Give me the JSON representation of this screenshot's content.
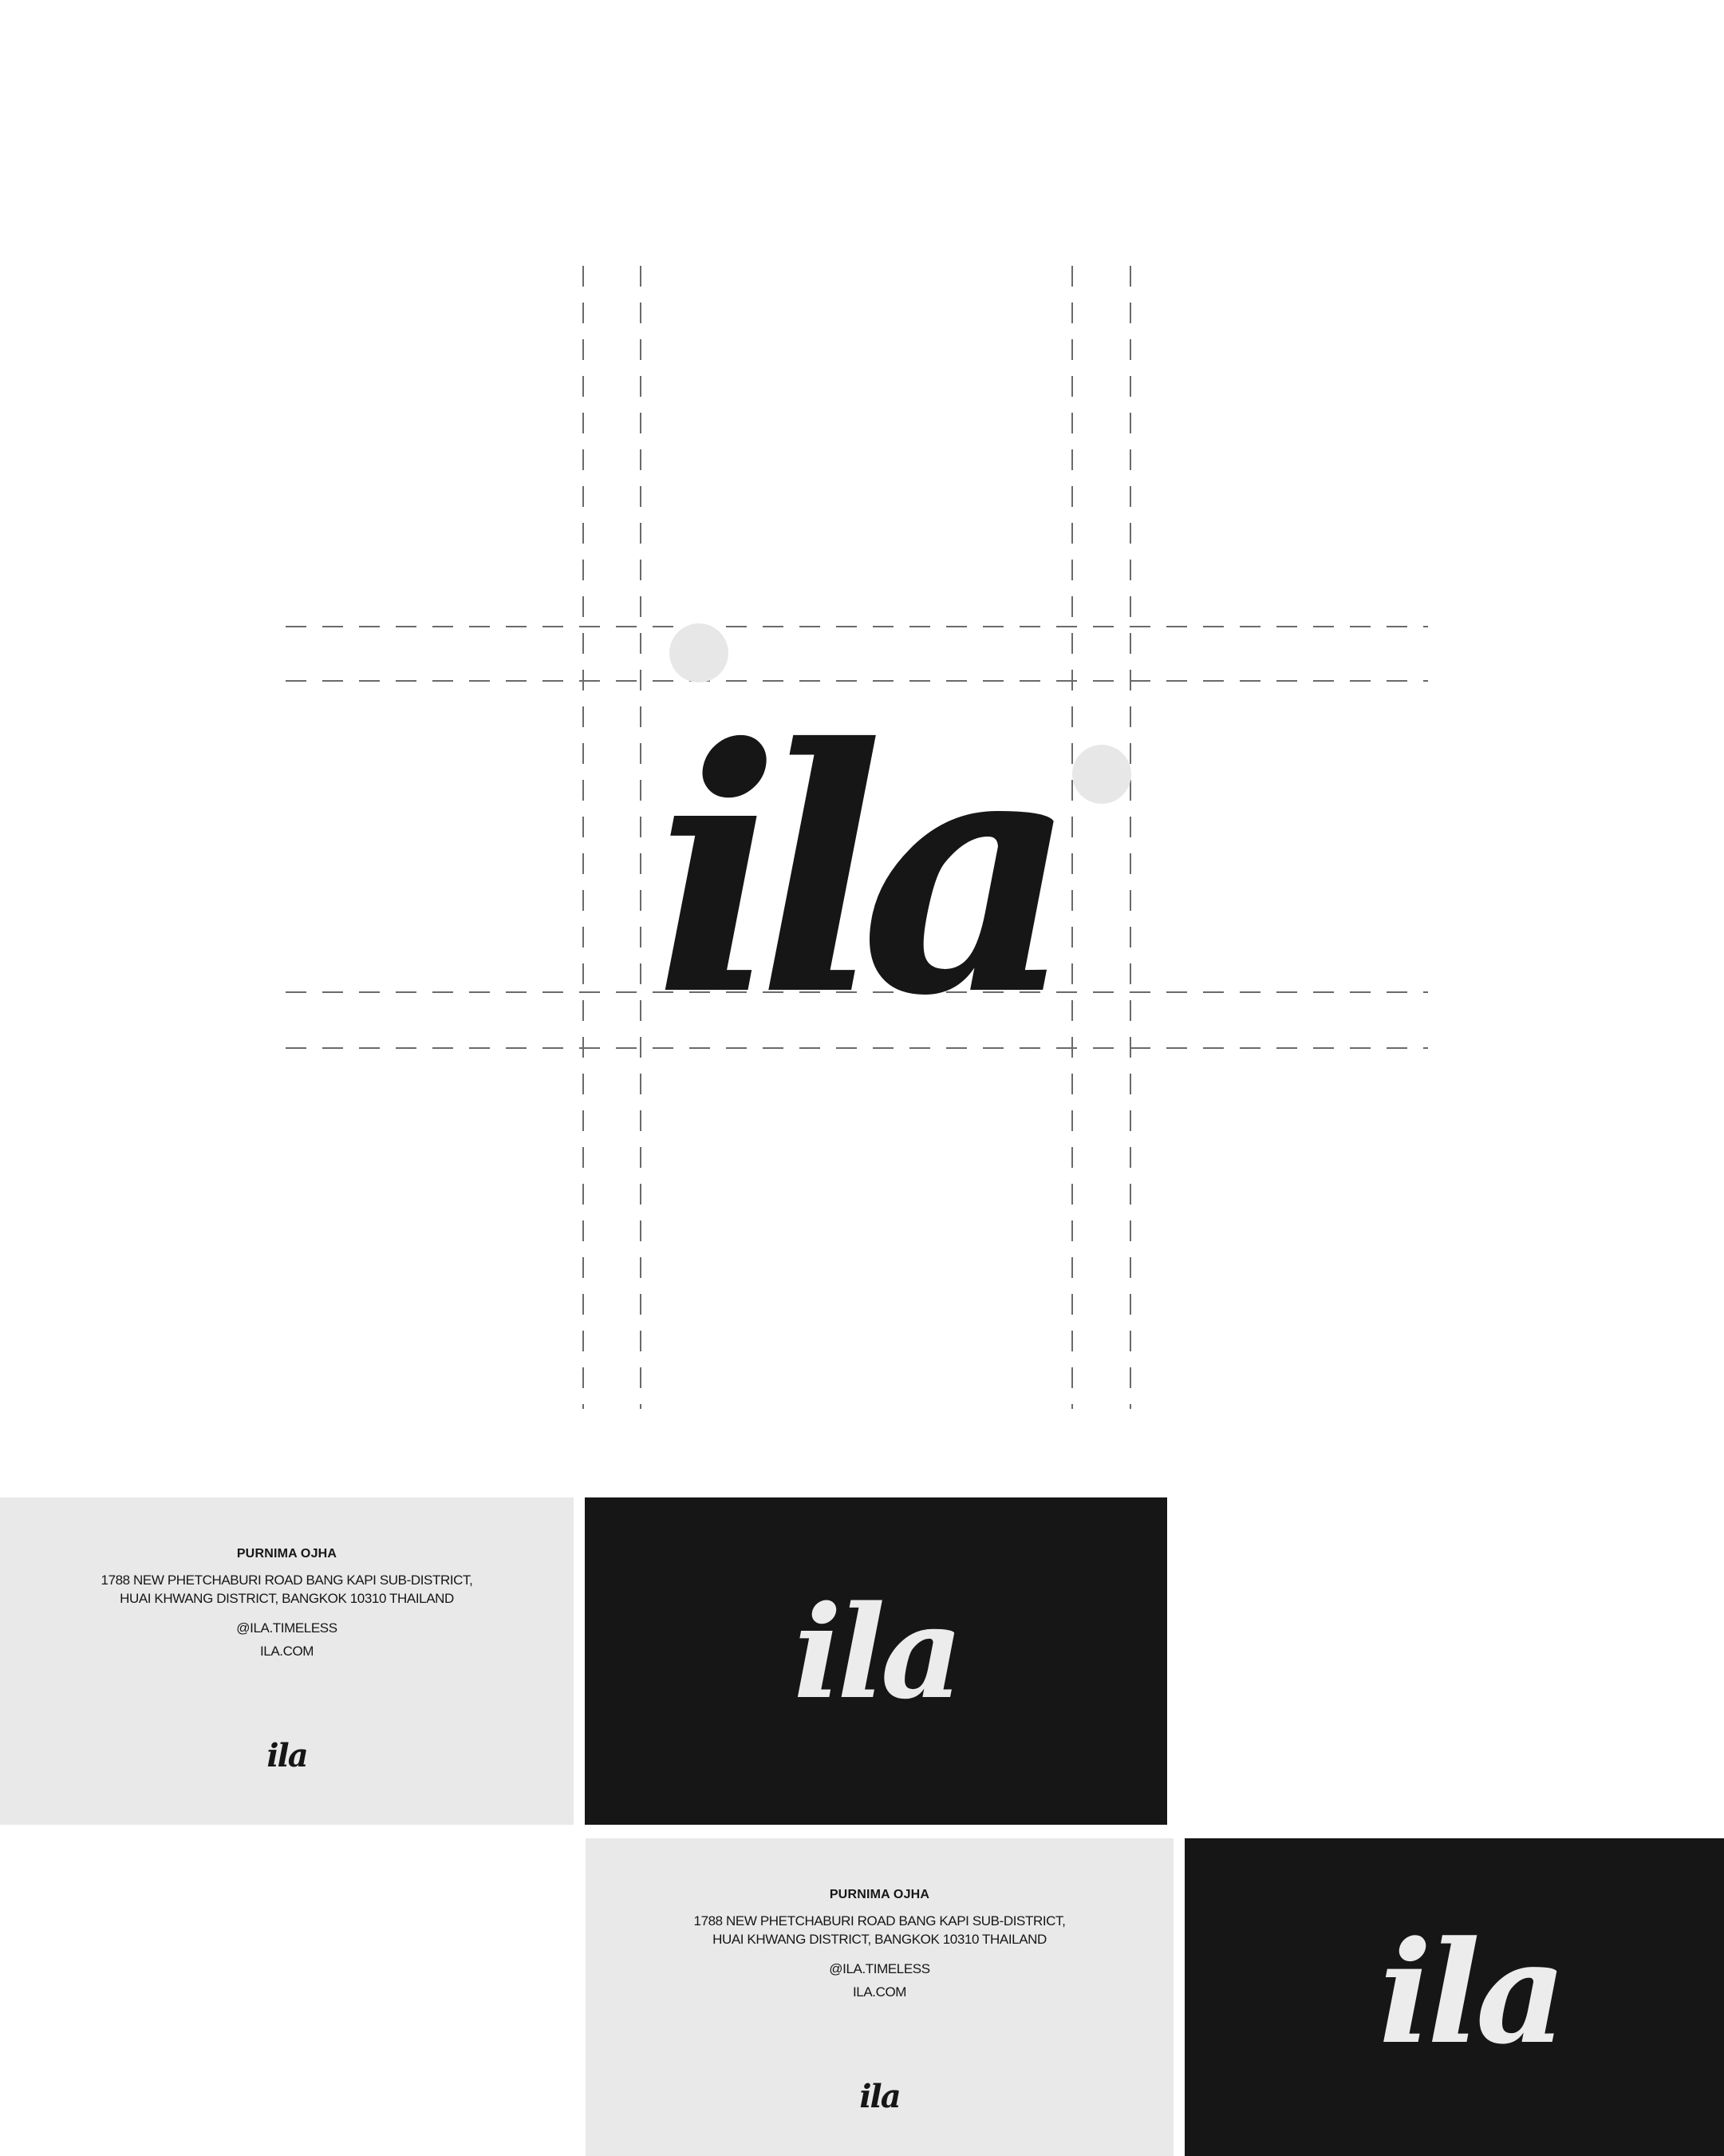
{
  "brand": {
    "logo": "ila"
  },
  "card": {
    "name": "PURNIMA OJHA",
    "address_line1": "1788 NEW PHETCHABURI ROAD BANG KAPI SUB-DISTRICT,",
    "address_line2": "HUAI KHWANG DISTRICT, BANGKOK 10310 THAILAND",
    "social": "@ILA.TIMELESS",
    "website": "ILA.COM"
  },
  "colors": {
    "ink": "#161616",
    "paper": "#e9e9e9",
    "accent_circle": "#e7e7e7",
    "background": "#ffffff"
  }
}
